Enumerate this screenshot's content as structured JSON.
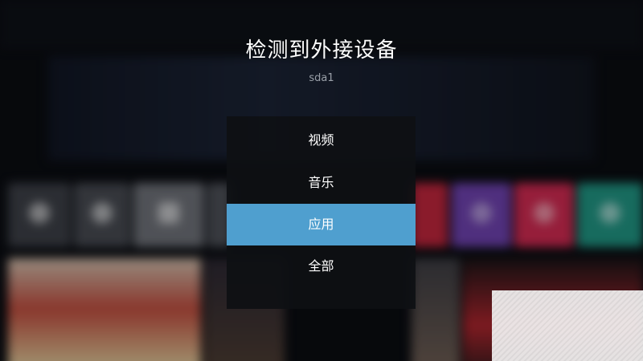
{
  "dialog": {
    "title": "检测到外接设备",
    "device": "sda1",
    "options": [
      {
        "label": "视频",
        "selected": false
      },
      {
        "label": "音乐",
        "selected": false
      },
      {
        "label": "应用",
        "selected": true
      },
      {
        "label": "全部",
        "selected": false
      }
    ]
  },
  "colors": {
    "selection": "#4f9fcf",
    "panel": "#0e1014",
    "background": "#0a0c11"
  }
}
